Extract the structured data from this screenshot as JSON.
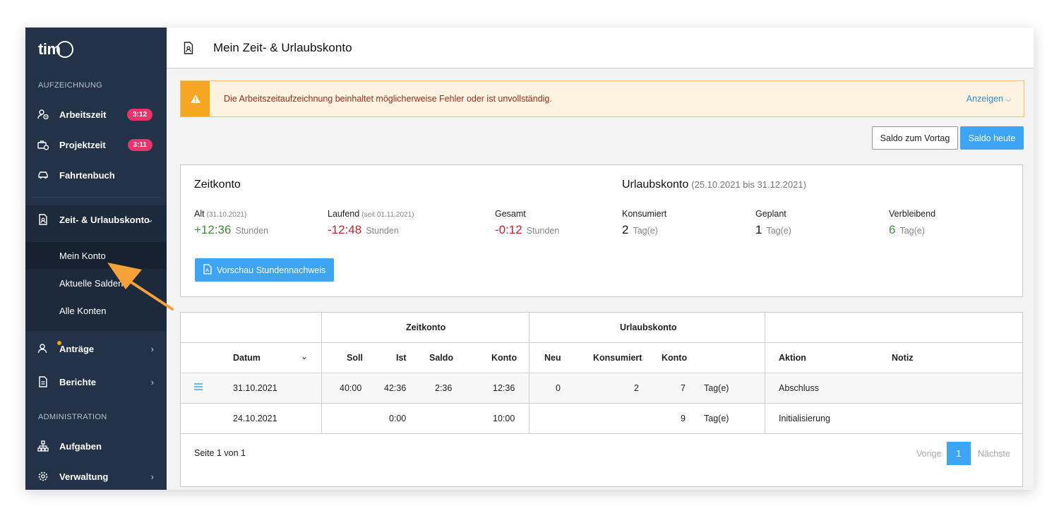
{
  "sidebar": {
    "section_aufzeichnung": "AUFZEICHNUNG",
    "section_administration": "ADMINISTRATION",
    "items": [
      {
        "label": "Arbeitszeit",
        "badge": "3:12"
      },
      {
        "label": "Projektzeit",
        "badge": "3:11"
      },
      {
        "label": "Fahrtenbuch"
      },
      {
        "label": "Zeit- & Urlaubskonto"
      },
      {
        "label": "Anträge"
      },
      {
        "label": "Berichte"
      },
      {
        "label": "Aufgaben"
      },
      {
        "label": "Verwaltung"
      }
    ],
    "subitems": [
      {
        "label": "Mein Konto"
      },
      {
        "label": "Aktuelle Salden"
      },
      {
        "label": "Alle Konten"
      }
    ]
  },
  "header": {
    "title": "Mein Zeit- & Urlaubskonto"
  },
  "alert": {
    "text": "Die Arbeitszeitaufzeichnung beinhaltet möglicherweise Fehler oder ist unvollständig.",
    "action": "Anzeigen"
  },
  "buttons": {
    "saldo_vortag": "Saldo zum Vortag",
    "saldo_heute": "Saldo heute"
  },
  "zeitkonto": {
    "title": "Zeitkonto",
    "alt": {
      "label": "Alt",
      "date": "(31.10.2021)",
      "value": "+12:36",
      "unit": "Stunden"
    },
    "laufend": {
      "label": "Laufend",
      "date": "(seit 01.11.2021)",
      "value": "-12:48",
      "unit": "Stunden"
    },
    "gesamt": {
      "label": "Gesamt",
      "value": "-0:12",
      "unit": "Stunden"
    }
  },
  "urlaubskonto": {
    "title": "Urlaubskonto",
    "range": "(25.10.2021 bis 31.12.2021)",
    "konsumiert": {
      "label": "Konsumiert",
      "value": "2",
      "unit": "Tag(e)"
    },
    "geplant": {
      "label": "Geplant",
      "value": "1",
      "unit": "Tag(e)"
    },
    "verbleibend": {
      "label": "Verbleibend",
      "value": "6",
      "unit": "Tag(e)"
    }
  },
  "pdf_button": "Vorschau Stundennachweis",
  "table": {
    "group_zeitkonto": "Zeitkonto",
    "group_urlaubskonto": "Urlaubskonto",
    "headers": {
      "datum": "Datum",
      "soll": "Soll",
      "ist": "Ist",
      "saldo": "Saldo",
      "konto": "Konto",
      "neu": "Neu",
      "konsumiert": "Konsumiert",
      "ukonto": "Konto",
      "aktion": "Aktion",
      "notiz": "Notiz"
    },
    "rows": [
      {
        "datum": "31.10.2021",
        "soll": "40:00",
        "ist": "42:36",
        "saldo": "2:36",
        "konto": "12:36",
        "neu": "0",
        "konsumiert": "2",
        "ukonto": "7",
        "unit": "Tag(e)",
        "aktion": "Abschluss"
      },
      {
        "datum": "24.10.2021",
        "soll": "",
        "ist": "0:00",
        "saldo": "",
        "konto": "10:00",
        "neu": "",
        "konsumiert": "",
        "ukonto": "9",
        "unit": "Tag(e)",
        "aktion": "Initialisierung"
      }
    ]
  },
  "pagination": {
    "info": "Seite 1 von 1",
    "prev": "Vorige",
    "current": "1",
    "next": "Nächste"
  }
}
